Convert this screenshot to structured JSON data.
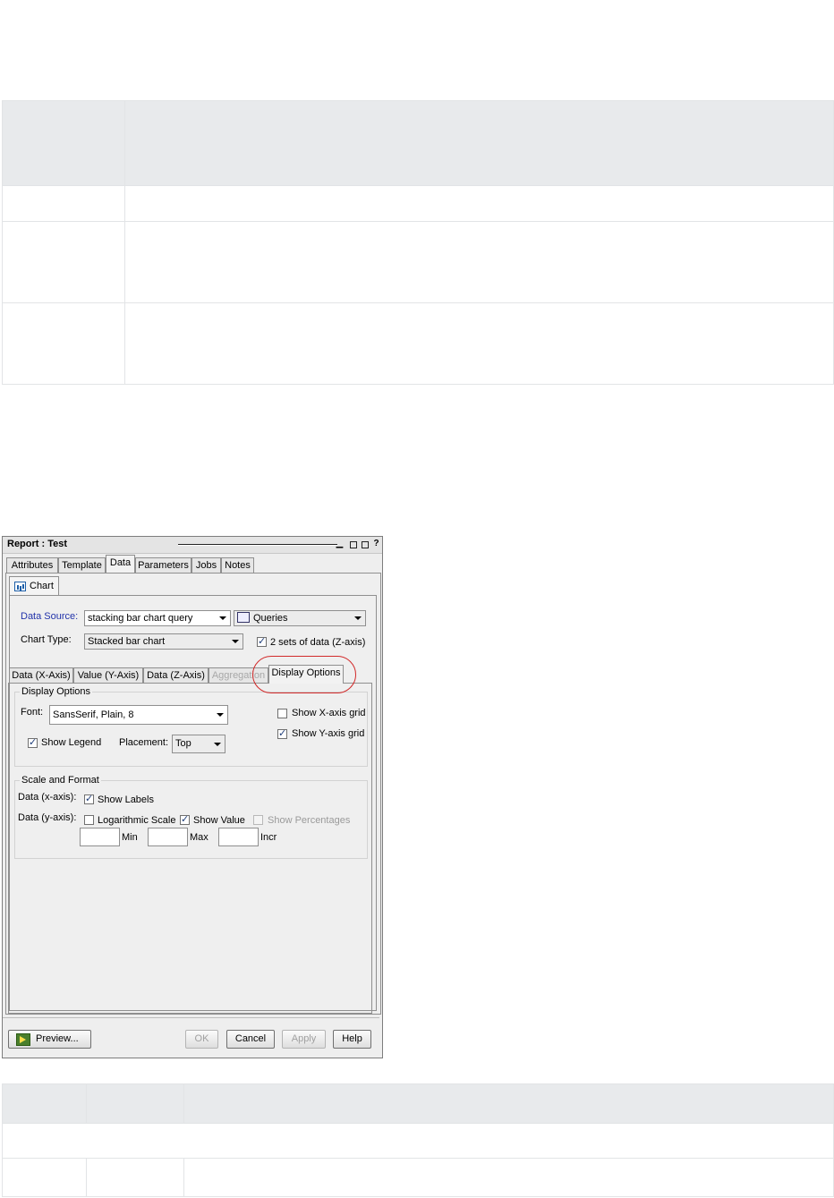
{
  "dialog": {
    "title": "Report : Test",
    "window_buttons": [
      "minimize-icon",
      "restore-icon",
      "maximize-icon",
      "help-icon"
    ],
    "help_glyph": "?",
    "tabs": [
      "Attributes",
      "Template",
      "Data",
      "Parameters",
      "Jobs",
      "Notes"
    ],
    "active_tab": "Data",
    "chart_tab": "Chart",
    "data_source": {
      "label": "Data Source:",
      "value": "stacking bar chart query",
      "queries_label": "Queries"
    },
    "chart_type": {
      "label": "Chart Type:",
      "value": "Stacked bar chart"
    },
    "z_axis": {
      "label": "2 sets of data (Z-axis)",
      "checked": true
    },
    "subtabs": [
      "Data (X-Axis)",
      "Value (Y-Axis)",
      "Data (Z-Axis)",
      "Aggregation",
      "Display Options"
    ],
    "active_subtab": "Display Options",
    "display_options": {
      "title": "Display Options",
      "font_label": "Font:",
      "font_value": "SansSerif, Plain, 8",
      "show_x_grid": {
        "label": "Show X-axis grid",
        "checked": false
      },
      "show_y_grid": {
        "label": "Show Y-axis grid",
        "checked": true
      },
      "show_legend": {
        "label": "Show Legend",
        "checked": true
      },
      "placement_label": "Placement:",
      "placement_value": "Top"
    },
    "scale_format": {
      "title": "Scale and Format",
      "x_label": "Data (x-axis):",
      "show_labels": {
        "label": "Show Labels",
        "checked": true
      },
      "y_label": "Data (y-axis):",
      "log_scale": {
        "label": "Logarithmic Scale",
        "checked": false
      },
      "show_value": {
        "label": "Show Value",
        "checked": true
      },
      "show_percentages": {
        "label": "Show Percentages",
        "checked": false
      },
      "min_label": "Min",
      "max_label": "Max",
      "incr_label": "Incr",
      "min_value": "",
      "max_value": "",
      "incr_value": ""
    },
    "buttons": {
      "preview": "Preview...",
      "ok": "OK",
      "cancel": "Cancel",
      "apply": "Apply",
      "help": "Help"
    }
  }
}
